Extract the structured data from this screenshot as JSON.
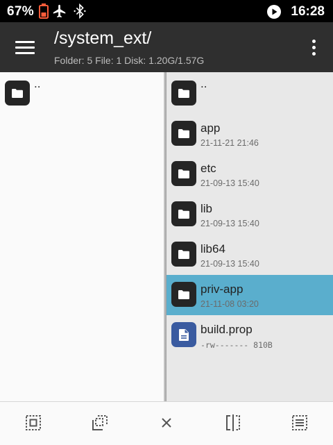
{
  "status_bar": {
    "battery_percent": "67%",
    "time": "16:28"
  },
  "app_bar": {
    "title": "/system_ext/",
    "subtitle": "Folder: 5  File: 1  Disk: 1.20G/1.57G"
  },
  "left_pane": {
    "items": [
      {
        "name": "..",
        "icon": "folder-icon"
      }
    ]
  },
  "right_pane": {
    "items": [
      {
        "name": "..",
        "meta": "",
        "icon": "folder-icon"
      },
      {
        "name": "app",
        "meta": "21-11-21 21:46",
        "icon": "folder-icon"
      },
      {
        "name": "etc",
        "meta": "21-09-13 15:40",
        "icon": "folder-icon"
      },
      {
        "name": "lib",
        "meta": "21-09-13 15:40",
        "icon": "folder-icon"
      },
      {
        "name": "lib64",
        "meta": "21-09-13 15:40",
        "icon": "folder-icon"
      },
      {
        "name": "priv-app",
        "meta": "21-11-08 03:20",
        "icon": "folder-icon",
        "selected": true
      },
      {
        "name": "build.prop",
        "meta": "-rw-------  810B",
        "icon": "document-icon"
      }
    ]
  },
  "bottom_toolbar": {
    "tools": [
      "select-all-icon",
      "select-range-icon",
      "close-icon",
      "split-view-icon",
      "select-list-icon"
    ]
  },
  "colors": {
    "app_bar": "#2f2f2f",
    "selected_row": "#5aaecd",
    "file_icon": "#3a5ba0",
    "battery": "#ff5c3a"
  }
}
